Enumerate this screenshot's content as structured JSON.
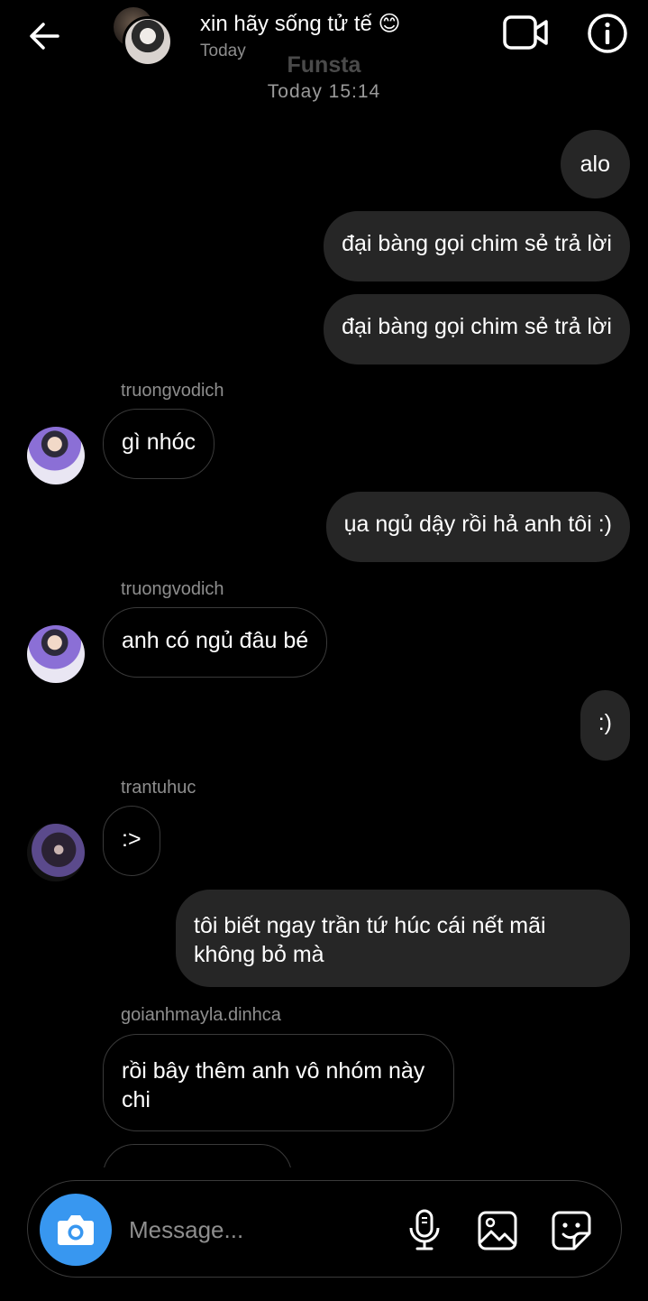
{
  "header": {
    "title": "xin hãy sống tử tế 😊",
    "subtitle": "Today",
    "icons": {
      "back": "arrow-left-icon",
      "video": "video-call-icon",
      "info": "info-icon"
    }
  },
  "watermark": "Funsta",
  "date_separator": "Today 15:14",
  "messages": [
    {
      "from": "me",
      "text": "alo"
    },
    {
      "from": "me",
      "text": "đại bàng gọi chim sẻ trả lời"
    },
    {
      "from": "me",
      "text": "đại bàng gọi chim sẻ trả lời"
    },
    {
      "from": "truongvodich",
      "sender": "truongvodich",
      "text": "gì nhóc"
    },
    {
      "from": "me",
      "text": "ụa ngủ dậy rồi hả anh tôi :)"
    },
    {
      "from": "truongvodich",
      "sender": "truongvodich",
      "text": "anh có ngủ đâu bé"
    },
    {
      "from": "me",
      "text": ":)"
    },
    {
      "from": "trantuhuc",
      "sender": "trantuhuc",
      "text": ":>"
    },
    {
      "from": "me",
      "text": "tôi biết ngay trần tứ húc cái nết mãi không bỏ mà"
    },
    {
      "from": "goianhmayla.dinhca",
      "sender": "goianhmayla.dinhca",
      "text": "rồi bây thêm anh vô nhóm này chi"
    }
  ],
  "composer": {
    "placeholder": "Message...",
    "icons": {
      "camera": "camera-icon",
      "mic": "microphone-icon",
      "gallery": "image-gallery-icon",
      "sticker": "sticker-icon"
    },
    "accent_color": "#3897f0"
  },
  "colors": {
    "background": "#000000",
    "outgoing_bubble": "#262626",
    "secondary_text": "#8e8e8e"
  }
}
